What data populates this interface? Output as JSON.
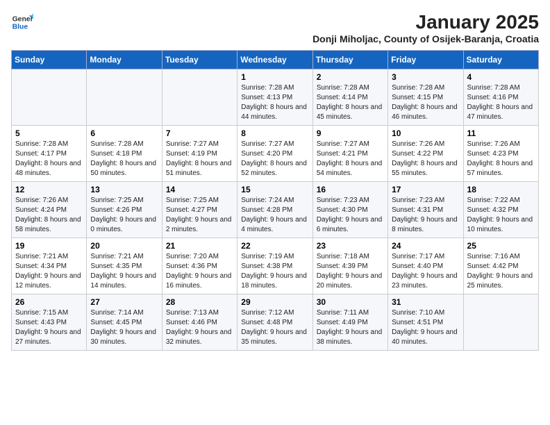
{
  "logo": {
    "general": "General",
    "blue": "Blue"
  },
  "title": "January 2025",
  "subtitle": "Donji Miholjac, County of Osijek-Baranja, Croatia",
  "days_of_week": [
    "Sunday",
    "Monday",
    "Tuesday",
    "Wednesday",
    "Thursday",
    "Friday",
    "Saturday"
  ],
  "weeks": [
    [
      {
        "day": "",
        "sunrise": "",
        "sunset": "",
        "daylight": ""
      },
      {
        "day": "",
        "sunrise": "",
        "sunset": "",
        "daylight": ""
      },
      {
        "day": "",
        "sunrise": "",
        "sunset": "",
        "daylight": ""
      },
      {
        "day": "1",
        "sunrise": "7:28 AM",
        "sunset": "4:13 PM",
        "daylight": "8 hours and 44 minutes."
      },
      {
        "day": "2",
        "sunrise": "7:28 AM",
        "sunset": "4:14 PM",
        "daylight": "8 hours and 45 minutes."
      },
      {
        "day": "3",
        "sunrise": "7:28 AM",
        "sunset": "4:15 PM",
        "daylight": "8 hours and 46 minutes."
      },
      {
        "day": "4",
        "sunrise": "7:28 AM",
        "sunset": "4:16 PM",
        "daylight": "8 hours and 47 minutes."
      }
    ],
    [
      {
        "day": "5",
        "sunrise": "7:28 AM",
        "sunset": "4:17 PM",
        "daylight": "8 hours and 48 minutes."
      },
      {
        "day": "6",
        "sunrise": "7:28 AM",
        "sunset": "4:18 PM",
        "daylight": "8 hours and 50 minutes."
      },
      {
        "day": "7",
        "sunrise": "7:27 AM",
        "sunset": "4:19 PM",
        "daylight": "8 hours and 51 minutes."
      },
      {
        "day": "8",
        "sunrise": "7:27 AM",
        "sunset": "4:20 PM",
        "daylight": "8 hours and 52 minutes."
      },
      {
        "day": "9",
        "sunrise": "7:27 AM",
        "sunset": "4:21 PM",
        "daylight": "8 hours and 54 minutes."
      },
      {
        "day": "10",
        "sunrise": "7:26 AM",
        "sunset": "4:22 PM",
        "daylight": "8 hours and 55 minutes."
      },
      {
        "day": "11",
        "sunrise": "7:26 AM",
        "sunset": "4:23 PM",
        "daylight": "8 hours and 57 minutes."
      }
    ],
    [
      {
        "day": "12",
        "sunrise": "7:26 AM",
        "sunset": "4:24 PM",
        "daylight": "8 hours and 58 minutes."
      },
      {
        "day": "13",
        "sunrise": "7:25 AM",
        "sunset": "4:26 PM",
        "daylight": "9 hours and 0 minutes."
      },
      {
        "day": "14",
        "sunrise": "7:25 AM",
        "sunset": "4:27 PM",
        "daylight": "9 hours and 2 minutes."
      },
      {
        "day": "15",
        "sunrise": "7:24 AM",
        "sunset": "4:28 PM",
        "daylight": "9 hours and 4 minutes."
      },
      {
        "day": "16",
        "sunrise": "7:23 AM",
        "sunset": "4:30 PM",
        "daylight": "9 hours and 6 minutes."
      },
      {
        "day": "17",
        "sunrise": "7:23 AM",
        "sunset": "4:31 PM",
        "daylight": "9 hours and 8 minutes."
      },
      {
        "day": "18",
        "sunrise": "7:22 AM",
        "sunset": "4:32 PM",
        "daylight": "9 hours and 10 minutes."
      }
    ],
    [
      {
        "day": "19",
        "sunrise": "7:21 AM",
        "sunset": "4:34 PM",
        "daylight": "9 hours and 12 minutes."
      },
      {
        "day": "20",
        "sunrise": "7:21 AM",
        "sunset": "4:35 PM",
        "daylight": "9 hours and 14 minutes."
      },
      {
        "day": "21",
        "sunrise": "7:20 AM",
        "sunset": "4:36 PM",
        "daylight": "9 hours and 16 minutes."
      },
      {
        "day": "22",
        "sunrise": "7:19 AM",
        "sunset": "4:38 PM",
        "daylight": "9 hours and 18 minutes."
      },
      {
        "day": "23",
        "sunrise": "7:18 AM",
        "sunset": "4:39 PM",
        "daylight": "9 hours and 20 minutes."
      },
      {
        "day": "24",
        "sunrise": "7:17 AM",
        "sunset": "4:40 PM",
        "daylight": "9 hours and 23 minutes."
      },
      {
        "day": "25",
        "sunrise": "7:16 AM",
        "sunset": "4:42 PM",
        "daylight": "9 hours and 25 minutes."
      }
    ],
    [
      {
        "day": "26",
        "sunrise": "7:15 AM",
        "sunset": "4:43 PM",
        "daylight": "9 hours and 27 minutes."
      },
      {
        "day": "27",
        "sunrise": "7:14 AM",
        "sunset": "4:45 PM",
        "daylight": "9 hours and 30 minutes."
      },
      {
        "day": "28",
        "sunrise": "7:13 AM",
        "sunset": "4:46 PM",
        "daylight": "9 hours and 32 minutes."
      },
      {
        "day": "29",
        "sunrise": "7:12 AM",
        "sunset": "4:48 PM",
        "daylight": "9 hours and 35 minutes."
      },
      {
        "day": "30",
        "sunrise": "7:11 AM",
        "sunset": "4:49 PM",
        "daylight": "9 hours and 38 minutes."
      },
      {
        "day": "31",
        "sunrise": "7:10 AM",
        "sunset": "4:51 PM",
        "daylight": "9 hours and 40 minutes."
      },
      {
        "day": "",
        "sunrise": "",
        "sunset": "",
        "daylight": ""
      }
    ]
  ]
}
